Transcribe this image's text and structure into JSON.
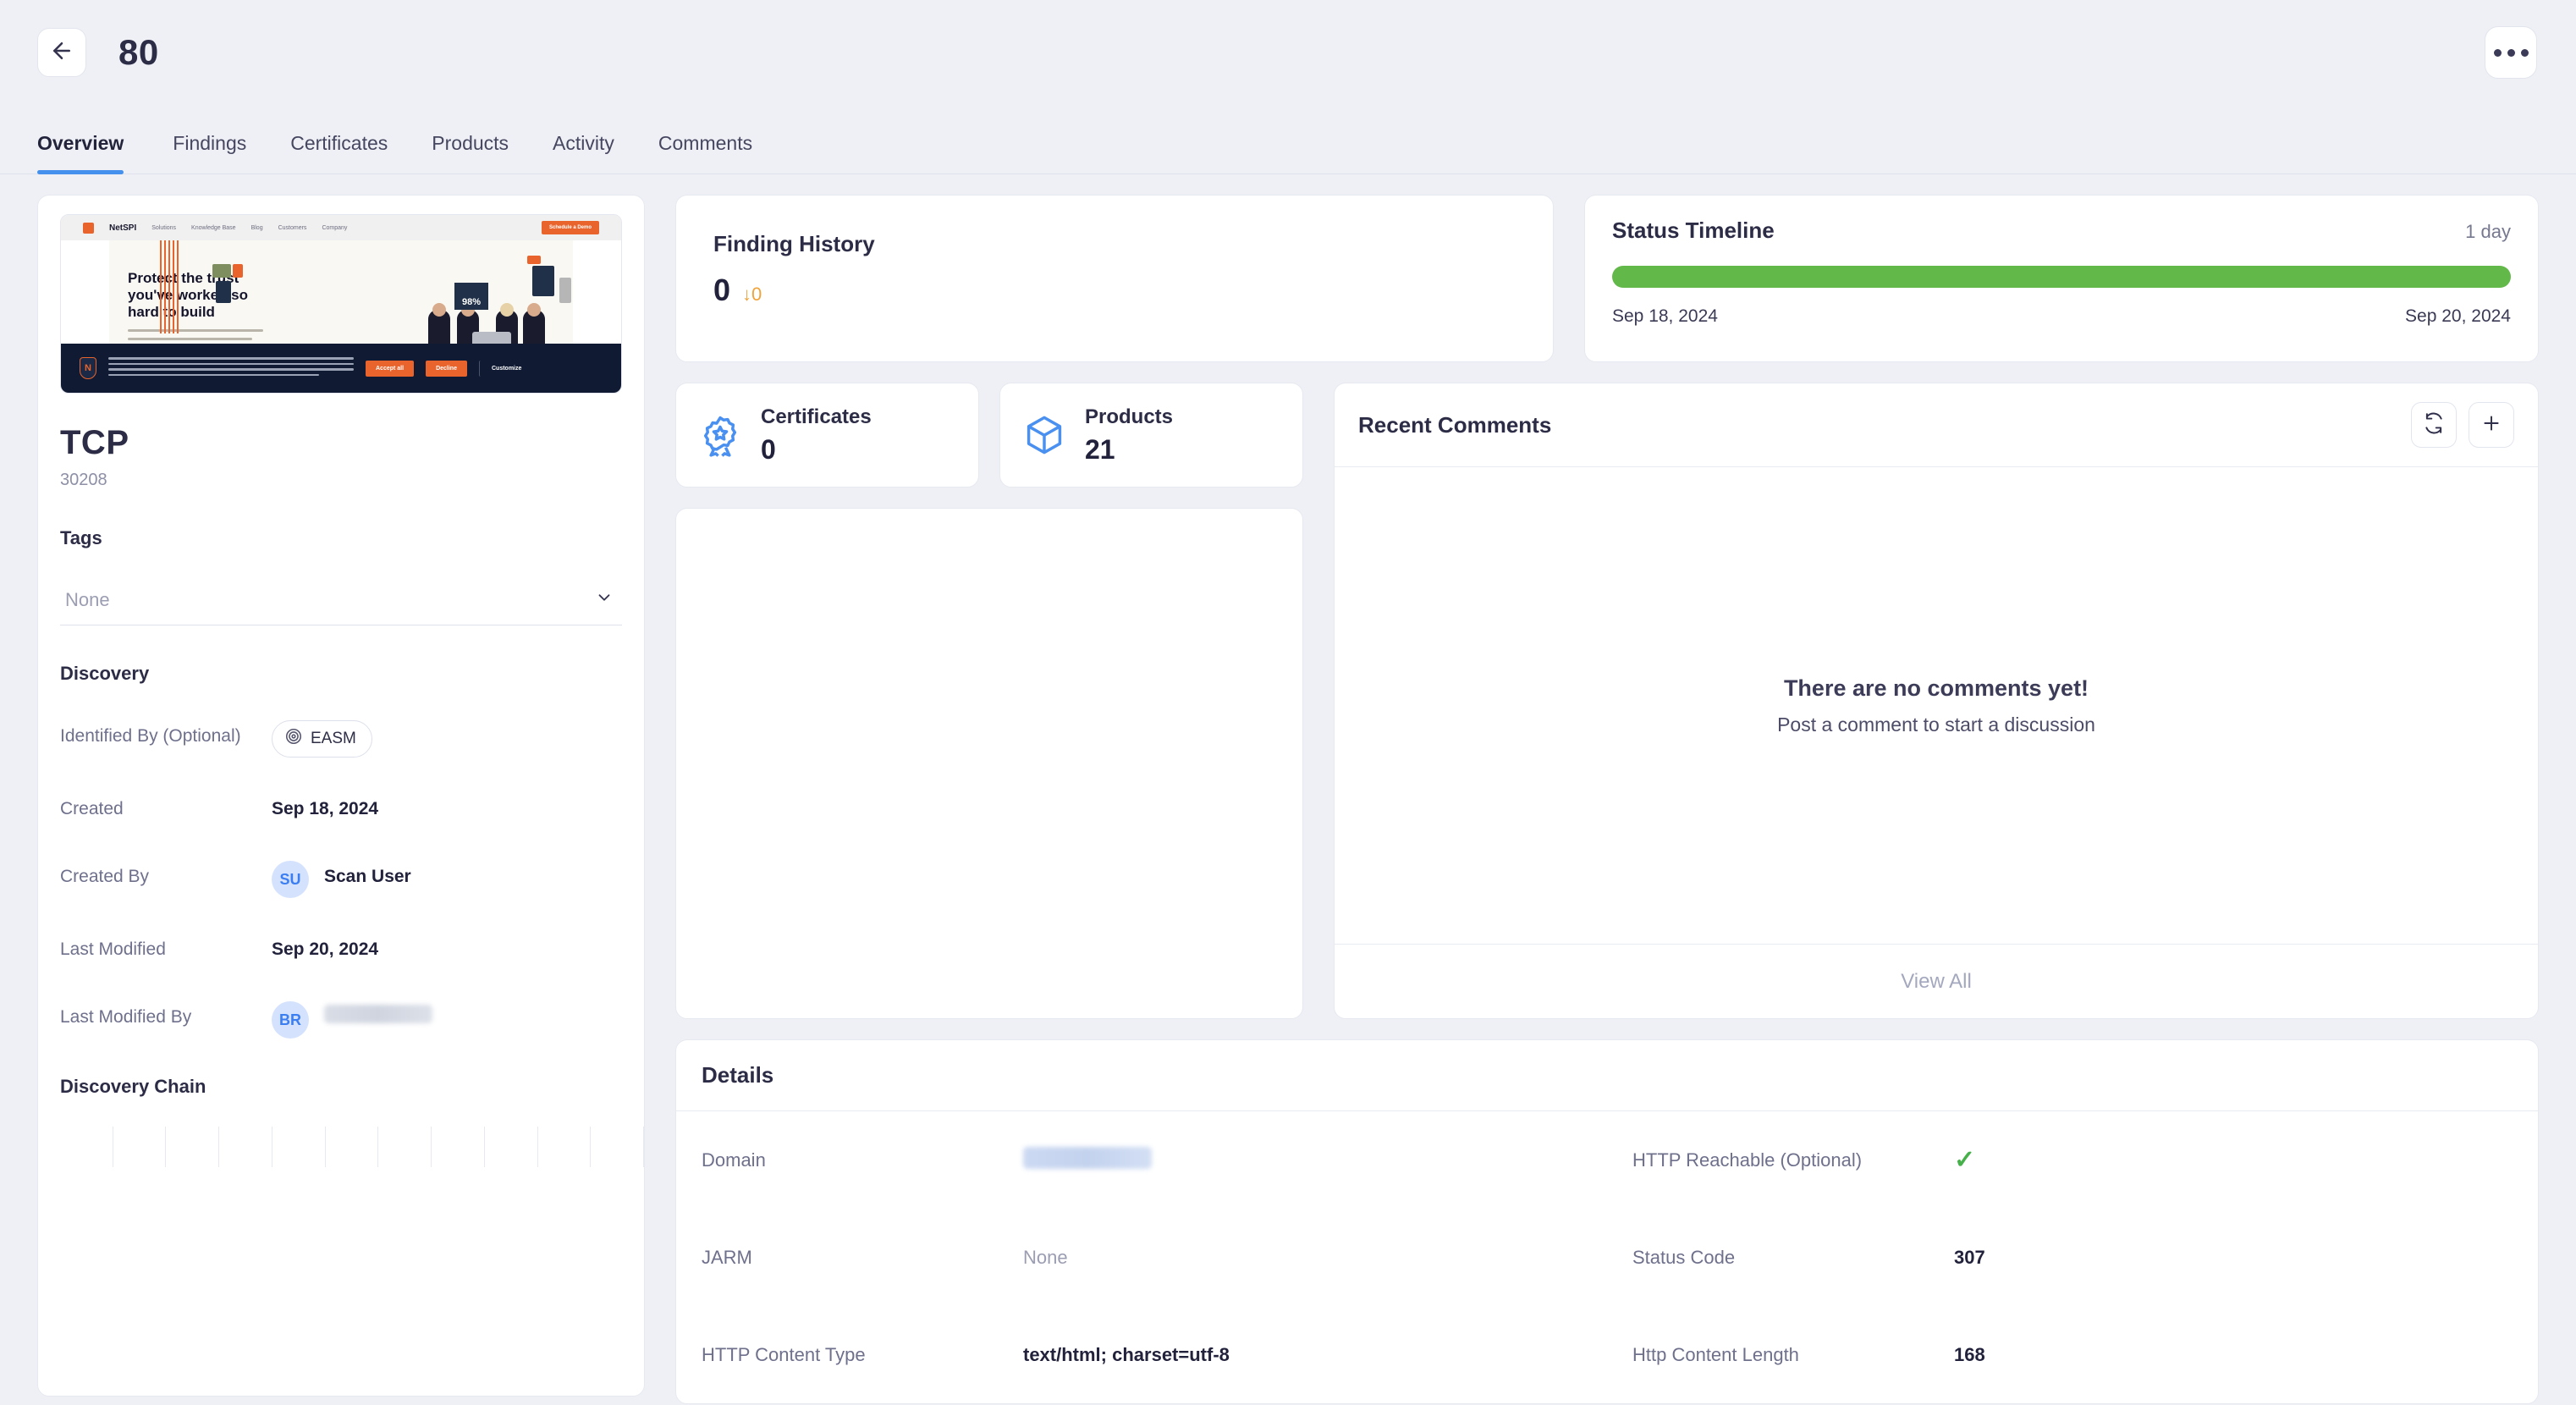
{
  "header": {
    "back_icon": "arrow-left-icon",
    "title": "80",
    "more_icon": "more-horizontal-icon"
  },
  "tabs": [
    {
      "label": "Overview",
      "active": true
    },
    {
      "label": "Findings",
      "active": false
    },
    {
      "label": "Certificates",
      "active": false
    },
    {
      "label": "Products",
      "active": false
    },
    {
      "label": "Activity",
      "active": false
    },
    {
      "label": "Comments",
      "active": false
    }
  ],
  "sidebar": {
    "preview": {
      "brand": "NetSPI",
      "nav": [
        "Solutions",
        "Knowledge Base",
        "Blog",
        "Customers",
        "Company"
      ],
      "cta": "Schedule a Demo",
      "headline": "Protect the trust you've worked so hard to build",
      "stat": "98%",
      "cookie_buttons": [
        "Accept all",
        "Decline",
        "Customize"
      ]
    },
    "asset_type": "TCP",
    "asset_id": "30208",
    "tags_label": "Tags",
    "tags_value": "None",
    "tags_chevron_icon": "chevron-down-icon",
    "discovery_label": "Discovery",
    "fields": [
      {
        "label": "Identified By (Optional)",
        "value": "EASM",
        "kind": "badge",
        "icon": "target-icon"
      },
      {
        "label": "Created",
        "value": "Sep 18, 2024",
        "kind": "text"
      },
      {
        "label": "Created By",
        "value": "Scan User",
        "kind": "avatar",
        "initials": "SU"
      },
      {
        "label": "Last Modified",
        "value": "Sep 20, 2024",
        "kind": "text"
      },
      {
        "label": "Last Modified By",
        "value": "",
        "kind": "avatar-redacted",
        "initials": "BR"
      }
    ],
    "discovery_chain_label": "Discovery Chain"
  },
  "finding_history": {
    "title": "Finding History",
    "count": "0",
    "delta": "0",
    "delta_direction_icon": "arrow-down-icon",
    "delta_color": "#f0a33a"
  },
  "status_timeline": {
    "title": "Status Timeline",
    "duration": "1 day",
    "bar_color": "#63b84a",
    "start_date": "Sep 18, 2024",
    "end_date": "Sep 20, 2024"
  },
  "stats": [
    {
      "label": "Certificates",
      "value": "0",
      "icon": "certificate-ribbon-icon"
    },
    {
      "label": "Products",
      "value": "21",
      "icon": "cube-icon"
    }
  ],
  "comments": {
    "title": "Recent Comments",
    "refresh_icon": "refresh-icon",
    "add_icon": "plus-icon",
    "empty_title": "There are no comments yet!",
    "empty_subtitle": "Post a comment to start a discussion",
    "view_all": "View All"
  },
  "details": {
    "title": "Details",
    "rows": [
      {
        "label": "Domain",
        "value": "",
        "kind": "redacted"
      },
      {
        "label": "HTTP Reachable (Optional)",
        "value": "✓",
        "kind": "check"
      },
      {
        "label": "JARM",
        "value": "None",
        "kind": "muted"
      },
      {
        "label": "Status Code",
        "value": "307",
        "kind": "text"
      },
      {
        "label": "HTTP Content Type",
        "value": "text/html; charset=utf-8",
        "kind": "text"
      },
      {
        "label": "Http Content Length",
        "value": "168",
        "kind": "text"
      }
    ]
  }
}
